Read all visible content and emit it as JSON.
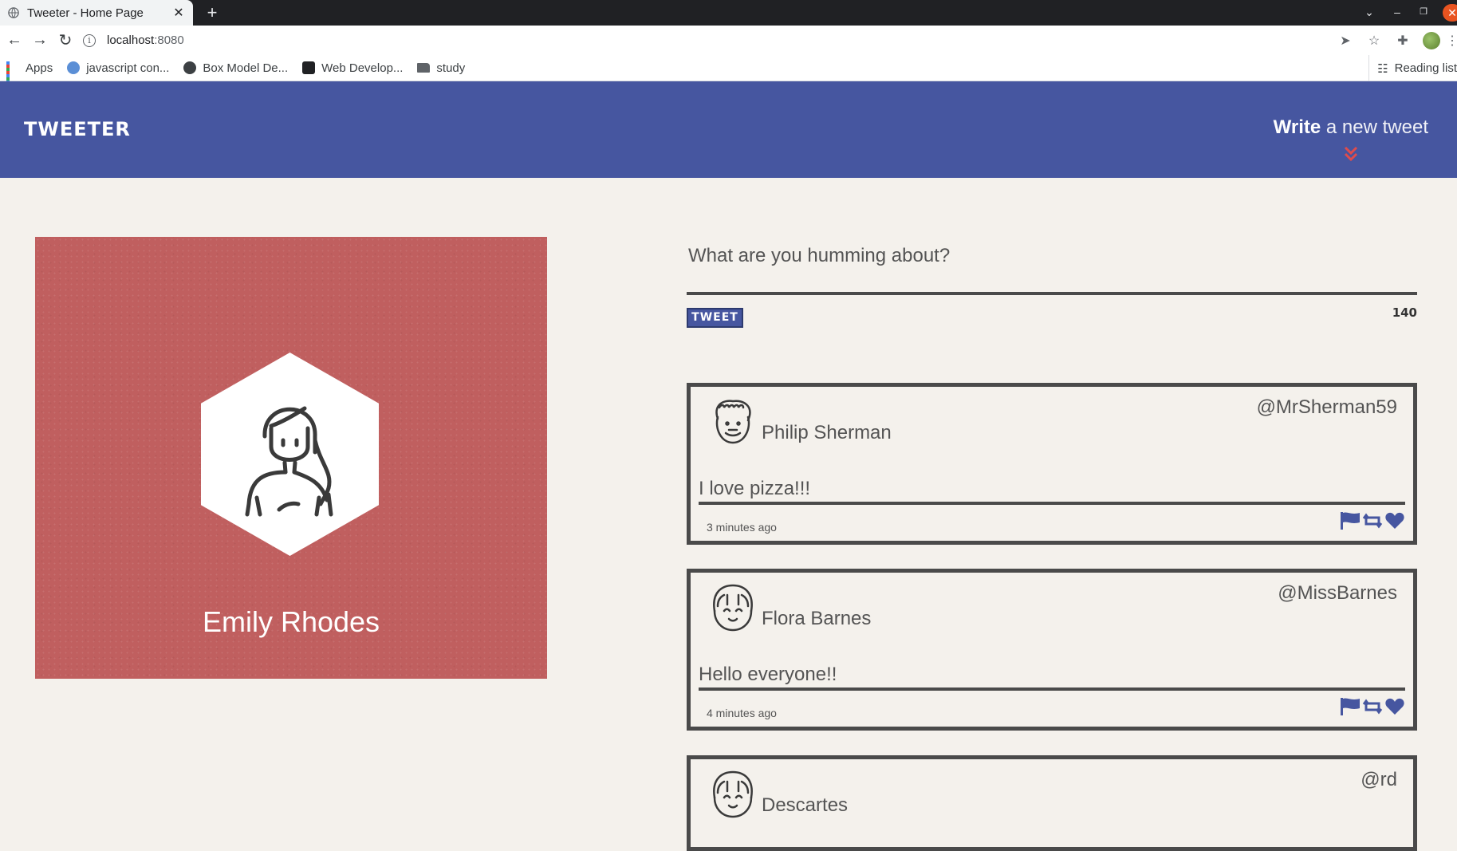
{
  "browser": {
    "tab_title": "Tweeter - Home Page",
    "url_host": "localhost",
    "url_port": ":8080",
    "bookmarks": [
      "Apps",
      "javascript con...",
      "Box Model De...",
      "Web Develop...",
      "study"
    ],
    "reading_list": "Reading list"
  },
  "header": {
    "brand": "TWEETER",
    "write_bold": "Write",
    "write_rest": " a new tweet"
  },
  "profile": {
    "name": "Emily Rhodes"
  },
  "composer": {
    "placeholder": "What are you humming about?",
    "button": "TWEET",
    "counter": "140"
  },
  "tweets": [
    {
      "name": "Philip Sherman",
      "handle": "@MrSherman59",
      "content": "I love pizza!!!",
      "time": "3 minutes ago"
    },
    {
      "name": "Flora Barnes",
      "handle": "@MissBarnes",
      "content": "Hello everyone!!",
      "time": "4 minutes ago"
    },
    {
      "name": "Descartes",
      "handle": "@rd",
      "content": "",
      "time": ""
    }
  ],
  "colors": {
    "header_bg": "#4656a0",
    "accent_red": "#e04c4c",
    "profile_bg": "#c05f5f",
    "page_bg": "#f4f1ec",
    "border": "#4a4a4a"
  }
}
